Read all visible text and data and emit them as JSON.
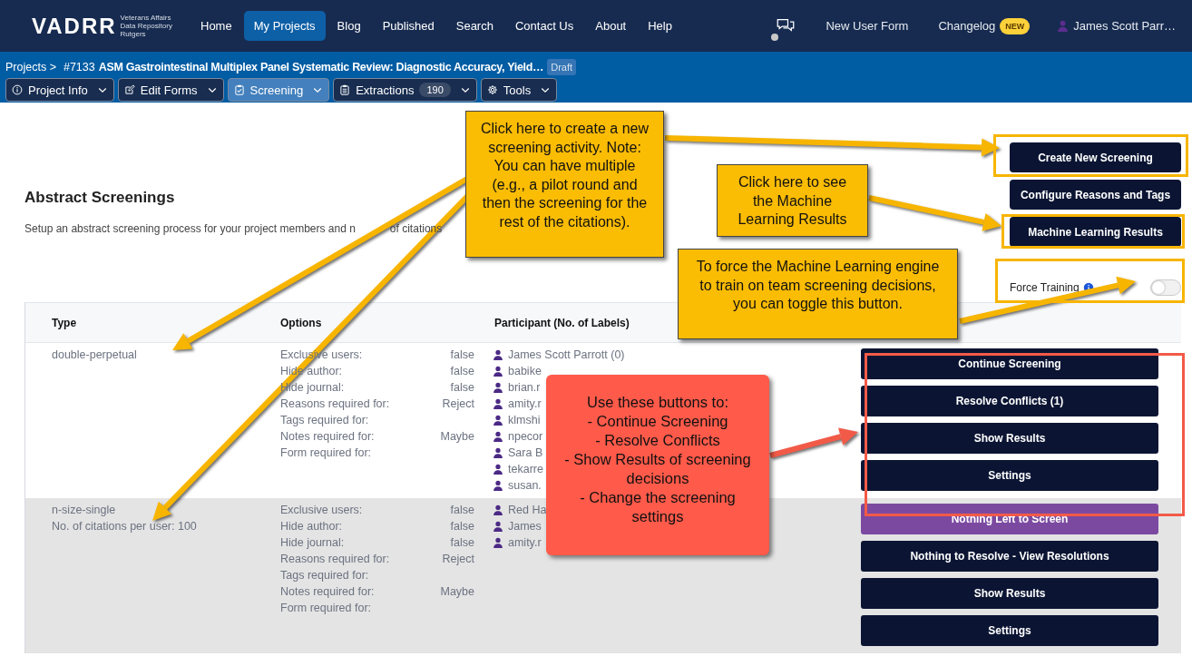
{
  "nav": {
    "logo": {
      "name": "VADRR",
      "subtitle": [
        "Veterans Affairs",
        "Data Repository",
        "Rutgers"
      ]
    },
    "links": [
      {
        "label": "Home",
        "selected": false
      },
      {
        "label": "My Projects",
        "selected": true
      },
      {
        "label": "Blog",
        "selected": false
      },
      {
        "label": "Published",
        "selected": false
      },
      {
        "label": "Search",
        "selected": false
      },
      {
        "label": "Contact Us",
        "selected": false
      },
      {
        "label": "About",
        "selected": false
      },
      {
        "label": "Help",
        "selected": false
      }
    ],
    "new_user_form": "New User Form",
    "changelog": {
      "label": "Changelog",
      "badge": "NEW"
    },
    "user": "James Scott Parr…"
  },
  "project": {
    "breadcrumb": "Projects >",
    "number": "#7133",
    "title": "ASM Gastrointestinal Multiplex Panel Systematic Review: Diagnostic Accuracy, Yield…",
    "status": "Draft",
    "tabs": [
      {
        "label": "Project Info",
        "selected": false
      },
      {
        "label": "Edit Forms",
        "selected": false
      },
      {
        "label": "Screening",
        "selected": true
      },
      {
        "label": "Extractions",
        "count": "190",
        "selected": false
      },
      {
        "label": "Tools",
        "selected": false
      }
    ]
  },
  "page": {
    "title": "Abstract Screenings",
    "description": "Setup an abstract screening process for your project members and n",
    "description_end": "of citations"
  },
  "actions": [
    "Create New Screening",
    "Configure Reasons and Tags",
    "Machine Learning Results"
  ],
  "force_training": {
    "label": "Force Training",
    "on": false
  },
  "table": {
    "columns": [
      "Type",
      "Options",
      "Participant (No. of Labels)"
    ],
    "rows": [
      {
        "type": [
          "double-perpetual"
        ],
        "options": [
          {
            "label": "Exclusive users:",
            "value": "false"
          },
          {
            "label": "Hide author:",
            "value": "false"
          },
          {
            "label": "Hide journal:",
            "value": "false"
          },
          {
            "label": "Reasons required for:",
            "value": "Reject"
          },
          {
            "label": "Tags required for:"
          },
          {
            "label": "Notes required for:",
            "value": "Maybe"
          },
          {
            "label": "Form required for:"
          }
        ],
        "participants": [
          "James Scott Parrott (0)",
          "babike",
          "brian.r",
          "amity.r",
          "klmshi",
          "npecor",
          "Sara B",
          "tekarre",
          "susan."
        ],
        "buttons": [
          {
            "label": "Continue Screening",
            "kind": "action"
          },
          {
            "label": "Resolve Conflicts (1)",
            "kind": "action"
          },
          {
            "label": "Show Results",
            "kind": "action"
          },
          {
            "label": "Settings",
            "kind": "action"
          }
        ]
      },
      {
        "type": [
          "n-size-single",
          "No. of citations per user: 100"
        ],
        "options": [
          {
            "label": "Exclusive users:",
            "value": "false"
          },
          {
            "label": "Hide author:",
            "value": "false"
          },
          {
            "label": "Hide journal:",
            "value": "false"
          },
          {
            "label": "Reasons required for:",
            "value": "Reject"
          },
          {
            "label": "Tags required for:"
          },
          {
            "label": "Notes required for:",
            "value": "Maybe"
          },
          {
            "label": "Form required for:"
          }
        ],
        "participants": [
          "Red Ha",
          "James",
          "amity.r"
        ],
        "buttons": [
          {
            "label": "Nothing Left to Screen",
            "kind": "complete"
          },
          {
            "label": "Nothing to Resolve - View Resolutions",
            "kind": "action"
          },
          {
            "label": "Show Results",
            "kind": "action"
          },
          {
            "label": "Settings",
            "kind": "action"
          }
        ]
      }
    ]
  },
  "callouts": [
    {
      "kind": "note",
      "text": "Click here to create a new screening activity. Note: You can have multiple (e.g., a pilot round and then the screening for the rest of the citations)."
    },
    {
      "kind": "note",
      "text": "Click here to see the Machine Learning Results"
    },
    {
      "kind": "note",
      "text": "To force the Machine Learning engine to train on team screening decisions, you can toggle this button."
    },
    {
      "kind": "warning",
      "text": "Use these buttons to:\n- Continue Screening\n- Resolve Conflicts\n- Show Results of screening decisions\n- Change the screening settings"
    }
  ]
}
